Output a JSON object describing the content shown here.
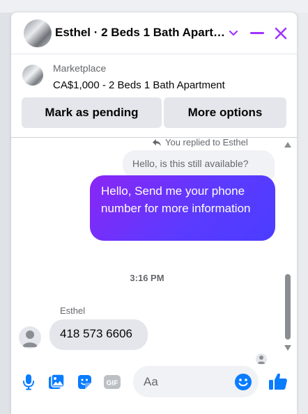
{
  "header": {
    "title": "Esthel · 2 Beds 1 Bath Apartment"
  },
  "marketplace": {
    "source": "Marketplace",
    "listing": "CA$1,000 - 2 Beds 1 Bath Apartment",
    "mark_pending_label": "Mark as pending",
    "more_options_label": "More options"
  },
  "messages": {
    "replied_label": "You replied to Esthel",
    "quoted_text": "Hello, is this still available?",
    "sent_text": "Hello, Send me your phone number for more information",
    "timestamp": "3:16 PM",
    "sender_name": "Esthel",
    "received_text": "418 573 6606"
  },
  "composer": {
    "placeholder": "Aa"
  },
  "icons": {
    "accent": "#a033ff",
    "composer_icons": "#0a7cff"
  }
}
